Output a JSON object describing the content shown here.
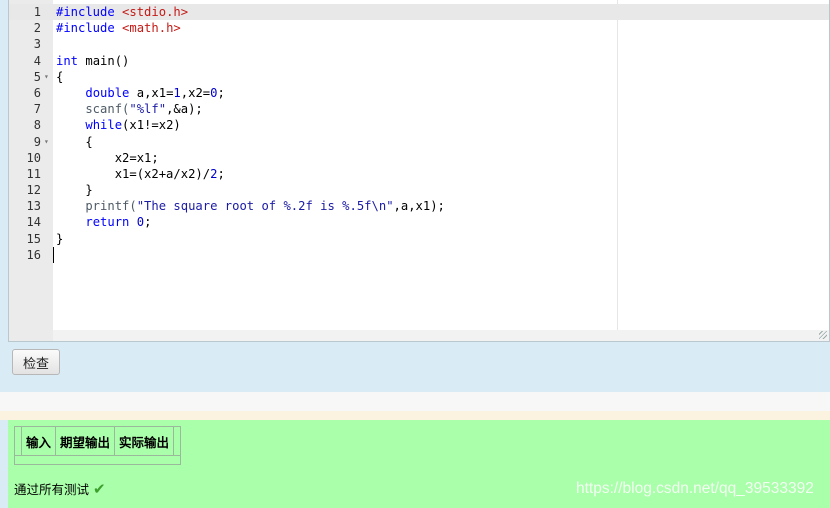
{
  "editor": {
    "lines": [
      {
        "num": "1",
        "fold": "",
        "tokens": [
          {
            "t": "#include ",
            "c": "k"
          },
          {
            "t": "<stdio.h>",
            "c": "inc"
          }
        ]
      },
      {
        "num": "2",
        "fold": "",
        "tokens": [
          {
            "t": "#include ",
            "c": "k"
          },
          {
            "t": "<math.h>",
            "c": "inc"
          }
        ]
      },
      {
        "num": "3",
        "fold": "",
        "tokens": []
      },
      {
        "num": "4",
        "fold": "",
        "tokens": [
          {
            "t": "int",
            "c": "k"
          },
          {
            "t": " main()",
            "c": "p"
          }
        ]
      },
      {
        "num": "5",
        "fold": "▾",
        "tokens": [
          {
            "t": "{",
            "c": "p"
          }
        ]
      },
      {
        "num": "6",
        "fold": "",
        "tokens": [
          {
            "t": "    ",
            "c": "p"
          },
          {
            "t": "double",
            "c": "k"
          },
          {
            "t": " a,x1=",
            "c": "p"
          },
          {
            "t": "1",
            "c": "n"
          },
          {
            "t": ",x2=",
            "c": "p"
          },
          {
            "t": "0",
            "c": "n"
          },
          {
            "t": ";",
            "c": "p"
          }
        ]
      },
      {
        "num": "7",
        "fold": "",
        "tokens": [
          {
            "t": "    scanf(",
            "c": "f"
          },
          {
            "t": "\"%lf\"",
            "c": "s"
          },
          {
            "t": ",&a);",
            "c": "p"
          }
        ]
      },
      {
        "num": "8",
        "fold": "",
        "tokens": [
          {
            "t": "    ",
            "c": "p"
          },
          {
            "t": "while",
            "c": "k"
          },
          {
            "t": "(x1!=x2)",
            "c": "p"
          }
        ]
      },
      {
        "num": "9",
        "fold": "▾",
        "tokens": [
          {
            "t": "    {",
            "c": "p"
          }
        ]
      },
      {
        "num": "10",
        "fold": "",
        "tokens": [
          {
            "t": "        x2=x1;",
            "c": "p"
          }
        ]
      },
      {
        "num": "11",
        "fold": "",
        "tokens": [
          {
            "t": "        x1=(x2+a/x2)/",
            "c": "p"
          },
          {
            "t": "2",
            "c": "n"
          },
          {
            "t": ";",
            "c": "p"
          }
        ]
      },
      {
        "num": "12",
        "fold": "",
        "tokens": [
          {
            "t": "    }",
            "c": "p"
          }
        ]
      },
      {
        "num": "13",
        "fold": "",
        "tokens": [
          {
            "t": "    printf(",
            "c": "f"
          },
          {
            "t": "\"The square root of %.2f is %.5f\\n\"",
            "c": "s"
          },
          {
            "t": ",a,x1);",
            "c": "p"
          }
        ]
      },
      {
        "num": "14",
        "fold": "",
        "tokens": [
          {
            "t": "    ",
            "c": "p"
          },
          {
            "t": "return",
            "c": "k"
          },
          {
            "t": " ",
            "c": "p"
          },
          {
            "t": "0",
            "c": "n"
          },
          {
            "t": ";",
            "c": "p"
          }
        ]
      },
      {
        "num": "15",
        "fold": "",
        "tokens": [
          {
            "t": "}",
            "c": "p"
          }
        ]
      },
      {
        "num": "16",
        "fold": "",
        "tokens": []
      }
    ]
  },
  "toolbar": {
    "check_label": "检查"
  },
  "result": {
    "headers": [
      "输入",
      "期望输出",
      "实际输出"
    ],
    "pass_text": "通过所有测试"
  },
  "watermark": "https://blog.csdn.net/qq_39533392",
  "colors": {
    "keyword": "#0000ff",
    "include": "#c41a16",
    "number": "#0000cd",
    "string": "#1a1aa6",
    "result_bg": "#aaffaa",
    "page_bg": "#d9ecf5"
  }
}
